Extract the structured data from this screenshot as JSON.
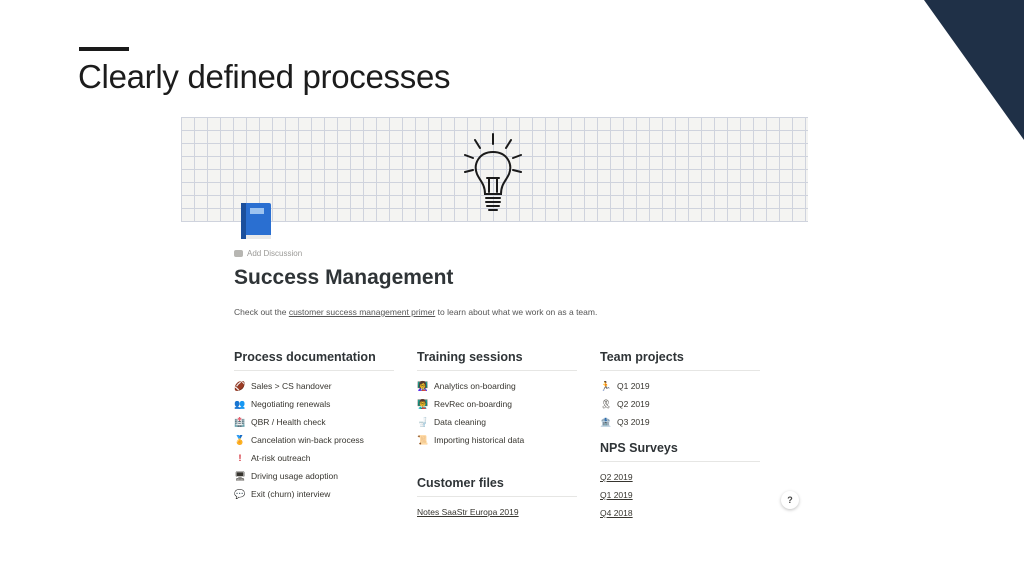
{
  "slide": {
    "title": "Clearly defined processes",
    "accent_color": "#1f3047"
  },
  "notion": {
    "add_discussion": "Add Discussion",
    "page_title": "Success Management",
    "intro": {
      "before": "Check out the ",
      "link": "customer success management primer",
      "after": " to learn about what we work on as a team."
    },
    "process_documentation": {
      "heading": "Process documentation",
      "items": [
        {
          "label": "Sales > CS handover",
          "icon": "football-icon"
        },
        {
          "label": "Negotiating renewals",
          "icon": "people-icon"
        },
        {
          "label": "QBR / Health check",
          "icon": "hospital-icon"
        },
        {
          "label": "Cancelation win-back process",
          "icon": "medal-icon"
        },
        {
          "label": "At-risk outreach",
          "icon": "exclamation-icon"
        },
        {
          "label": "Driving usage adoption",
          "icon": "monitor-icon"
        },
        {
          "label": "Exit (churn) interview",
          "icon": "speech-bubble-icon"
        }
      ]
    },
    "training_sessions": {
      "heading": "Training sessions",
      "items": [
        {
          "label": "Analytics on-boarding",
          "icon": "teacher-icon"
        },
        {
          "label": "RevRec on-boarding",
          "icon": "teacher-icon"
        },
        {
          "label": "Data cleaning",
          "icon": "toilet-icon"
        },
        {
          "label": "Importing historical data",
          "icon": "scroll-icon"
        }
      ]
    },
    "customer_files": {
      "heading": "Customer files",
      "items": [
        {
          "label": "Notes SaaStr Europa 2019"
        }
      ]
    },
    "team_projects": {
      "heading": "Team projects",
      "items": [
        {
          "label": "Q1 2019",
          "icon": "runner-icon"
        },
        {
          "label": "Q2 2019",
          "icon": "ribbon-icon"
        },
        {
          "label": "Q3 2019",
          "icon": "bank-icon"
        }
      ]
    },
    "nps_surveys": {
      "heading": "NPS Surveys",
      "items": [
        {
          "label": "Q2 2019"
        },
        {
          "label": "Q1 2019"
        },
        {
          "label": "Q4 2018"
        }
      ]
    },
    "help_label": "?"
  }
}
